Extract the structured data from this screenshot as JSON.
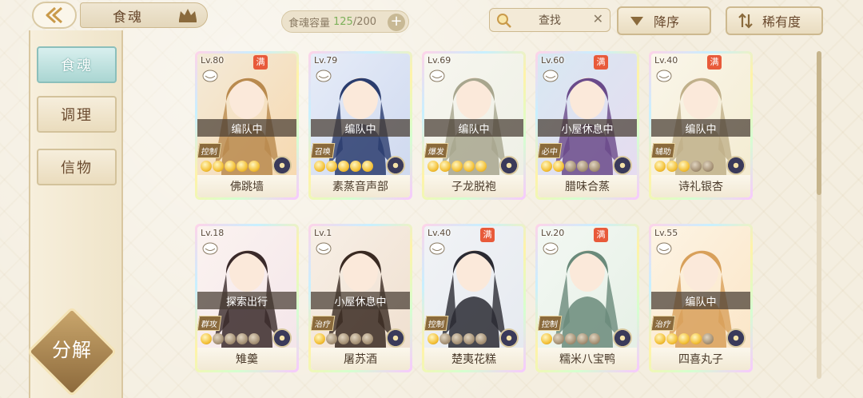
{
  "header": {
    "title": "食魂",
    "capacity_label": "食魂容量",
    "capacity_current": "125",
    "capacity_total": "/200",
    "capacity_add": "+",
    "search_label": "查找",
    "search_clear": "✕",
    "sort_label": "降序",
    "rarity_label": "稀有度"
  },
  "sidebar": {
    "items": [
      {
        "label": "食魂",
        "active": true
      },
      {
        "label": "调理",
        "active": false
      },
      {
        "label": "信物",
        "active": false
      }
    ],
    "decompose_label": "分解"
  },
  "colors": {
    "accent_teal": "#aad6d2",
    "gold": "#cdb98f",
    "max_badge": "#e85a3a",
    "capacity_current": "#7db05a"
  },
  "cards": [
    {
      "level": "Lv.80",
      "max": "满",
      "status": "编队中",
      "role": "控制",
      "stars_on": 5,
      "name": "佛跳墙",
      "palette": [
        "#f7d9b0",
        "#b98a4e",
        "#f3ead8"
      ]
    },
    {
      "level": "Lv.79",
      "max": "",
      "status": "编队中",
      "role": "召唤",
      "stars_on": 5,
      "name": "素蒸音声部",
      "palette": [
        "#cfd9ef",
        "#2a3c6e",
        "#e6ecf8"
      ]
    },
    {
      "level": "Lv.69",
      "max": "",
      "status": "编队中",
      "role": "爆发",
      "stars_on": 5,
      "name": "子龙脱袍",
      "palette": [
        "#eef0e6",
        "#a8a68e",
        "#f7f6ef"
      ]
    },
    {
      "level": "Lv.60",
      "max": "满",
      "status": "小屋休息中",
      "role": "必中",
      "stars_on": 2,
      "name": "腊味合蒸",
      "palette": [
        "#e6dcf0",
        "#6a4a8a",
        "#d8e8f2"
      ]
    },
    {
      "level": "Lv.40",
      "max": "满",
      "status": "编队中",
      "role": "辅助",
      "stars_on": 3,
      "name": "诗礼银杏",
      "palette": [
        "#f4ecd2",
        "#c0b08a",
        "#faf6ea"
      ]
    },
    {
      "level": "Lv.18",
      "max": "",
      "status": "探索出行",
      "role": "群攻",
      "stars_on": 1,
      "name": "雉羹",
      "palette": [
        "#f4e6ea",
        "#3a2a2a",
        "#fbf3f0"
      ]
    },
    {
      "level": "Lv.1",
      "max": "",
      "status": "小屋休息中",
      "role": "治疗",
      "stars_on": 1,
      "name": "屠苏酒",
      "palette": [
        "#f0e0d0",
        "#3a2a22",
        "#f7efe6"
      ]
    },
    {
      "level": "Lv.40",
      "max": "满",
      "status": "",
      "role": "控制",
      "stars_on": 1,
      "name": "楚夷花糕",
      "palette": [
        "#e6eaf0",
        "#2a2a32",
        "#f1f3f6"
      ]
    },
    {
      "level": "Lv.20",
      "max": "满",
      "status": "",
      "role": "控制",
      "stars_on": 1,
      "name": "糯米八宝鸭",
      "palette": [
        "#e6f0e6",
        "#6a8a7a",
        "#f3f8f3"
      ]
    },
    {
      "level": "Lv.55",
      "max": "",
      "status": "编队中",
      "role": "治疗",
      "stars_on": 4,
      "name": "四喜丸子",
      "palette": [
        "#fbe6c8",
        "#d8a05a",
        "#fdf4e4"
      ]
    }
  ]
}
